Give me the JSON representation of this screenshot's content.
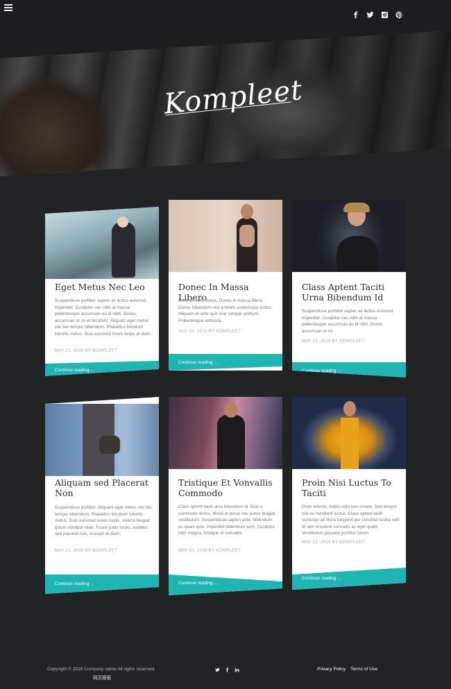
{
  "brand": {
    "logo_text": "Kompleet"
  },
  "header": {
    "social": [
      "facebook-icon",
      "twitter-icon",
      "instagram-icon",
      "pinterest-icon"
    ]
  },
  "posts": [
    {
      "title": "Eget Metus Nec Leo",
      "excerpt": "Suspendisse porttitor sapien ac lectus euismod imperdiet. Curabitur nec nibh at massa pellentesque accumsan eu id nibh. Donec accumsan ut mi et tincidunt. Aliquam eget metus nec leo tempor bibendum. Phasellus tincidunt lobortis metus. Duis euismod lorem turpis at diam.",
      "meta": "MAY 21, 2016 BY KOMPLEET",
      "cta": "Continue reading ..."
    },
    {
      "title": "Donec In Massa Libero",
      "excerpt": "Nunc eu velit metus. Donec in massa libero. Donec bibendum orci a lorem scelerisque luctus. Aliquam et ante quis erat semper pretium. Pellentesque vehicula.",
      "meta": "MAY 21, 2016 BY KOMPLEET",
      "cta": "Continue reading ..."
    },
    {
      "title": "Class Aptent Taciti Urna Bibendum Id",
      "excerpt": "Suspendisse porttitor sapien ac lectus euismod imperdiet. Curabitur nec nibh at massa pellentesque accumsan eu id nibh. Donec accumsan ut mi",
      "meta": "MAY 21, 2016 BY KOMPLEET",
      "cta": "Continue reading ..."
    },
    {
      "title": "Aliquam sed Placerat Non",
      "excerpt": "Suspendisse porttitor. Aliquam eget metus nec leo tempor bibendum. Phasellus tincidunt lobortis metus. Duis euismod lorem turpis, viverra feugiat ipsum volutpat vitae. Fusce justo turpis, sodales sed placerat non, suscipit at diam.",
      "meta": "MAY 21, 2016 BY KOMPLEET",
      "cta": "Continue reading ..."
    },
    {
      "title": "Tristique Et Vonvallis Commodo",
      "excerpt": "Class aptent taciti urna bibendum id. Duis a commodo lectus. Morbi id purus nec purus feugiat vestibulum. Suspendisse sapien ante, bibendum ac quam quis, imperdiet bibendum sem. Curabitur nibh magna, tristique et convallis.",
      "meta": "MAY 21, 2016 BY KOMPLEET",
      "cta": "Continue reading ..."
    },
    {
      "title": "Proin Nisi Luctus To Taciti",
      "excerpt": "Proin lobortis mattis odio non ornare. Sed tempor nisi eu hendrerit luctus. Class aptent taciti sociosqu ad litora torquent per conubia nostra velit id sem tincidunt convallis ac eget quam. Vestibulum posuere porttitor lorem.",
      "meta": "MAY 21, 2016 BY KOMPLEET",
      "cta": "Continue reading ..."
    }
  ],
  "footer": {
    "copyright": "Copyright © 2019 Company name All rights reserved.",
    "cn_link": "网页模板",
    "social": [
      "twitter-icon",
      "facebook-icon",
      "linkedin-icon"
    ],
    "links": [
      "Privacy Policy",
      "Terms of Use"
    ]
  },
  "colors": {
    "accent": "#1fb5b3",
    "background": "#222324"
  }
}
